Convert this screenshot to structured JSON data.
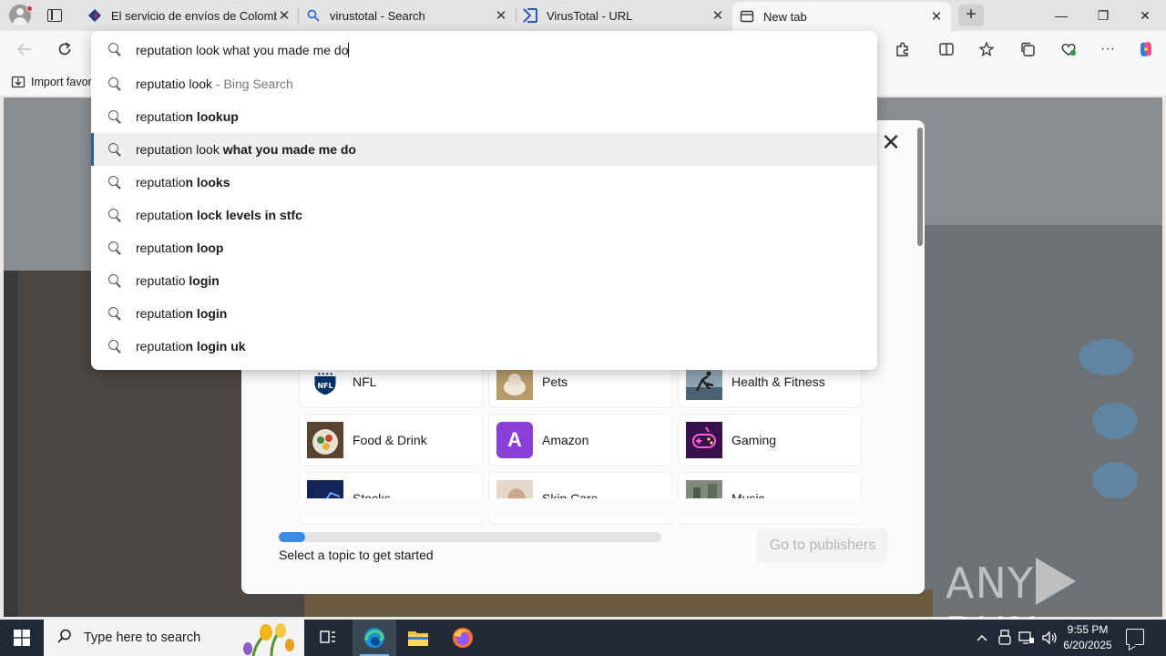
{
  "browser": {
    "tabs": [
      {
        "title": "El servicio de envíos de Colombia",
        "favicon": "servientrega-icon",
        "active": false
      },
      {
        "title": "virustotal - Search",
        "favicon": "bing-search-icon",
        "active": false
      },
      {
        "title": "VirusTotal - URL",
        "favicon": "virustotal-icon",
        "active": false
      },
      {
        "title": "New tab",
        "favicon": "newtab-icon",
        "active": true
      }
    ],
    "new_tab_glyph": "+",
    "window_controls": {
      "minimize": "—",
      "maximize": "❐",
      "close": "✕"
    },
    "favorites_bar": {
      "import_label": "Import favor"
    }
  },
  "omnibox": {
    "query": "reputation look what you made me do",
    "suggestions": [
      {
        "prefix": "reputatio look",
        "bold": "",
        "suffix": " - Bing Search",
        "selected": false
      },
      {
        "prefix": "reputatio",
        "bold": "n lookup",
        "suffix": "",
        "selected": false
      },
      {
        "prefix": "reputation look",
        "bold": " what you made me do",
        "suffix": "",
        "selected": true
      },
      {
        "prefix": "reputatio",
        "bold": "n looks",
        "suffix": "",
        "selected": false
      },
      {
        "prefix": "reputatio",
        "bold": "n lock levels in stfc",
        "suffix": "",
        "selected": false
      },
      {
        "prefix": "reputatio",
        "bold": "n loop",
        "suffix": "",
        "selected": false
      },
      {
        "prefix": "reputatio",
        "bold": " login",
        "suffix": "",
        "selected": false
      },
      {
        "prefix": "reputatio",
        "bold": "n login",
        "suffix": "",
        "selected": false
      },
      {
        "prefix": "reputatio",
        "bold": "n login uk",
        "suffix": "",
        "selected": false
      }
    ]
  },
  "topics_modal": {
    "close_glyph": "✕",
    "topics": [
      {
        "label": "NFL",
        "icon": "nfl-icon",
        "color": "#ffffff"
      },
      {
        "label": "Pets",
        "icon": "pets-icon",
        "color": "#c9a77a"
      },
      {
        "label": "Health & Fitness",
        "icon": "fitness-icon",
        "color": "#6c8aa0"
      },
      {
        "label": "Food & Drink",
        "icon": "food-icon",
        "color": "#7b5a3a"
      },
      {
        "label": "Amazon",
        "icon": "amazon-icon",
        "color": "#8b3fd9",
        "letter": "A"
      },
      {
        "label": "Gaming",
        "icon": "gaming-icon",
        "color": "#5a1a6e"
      },
      {
        "label": "Stocks",
        "icon": "stocks-icon",
        "color": "#1b2f6e"
      },
      {
        "label": "Skin Care",
        "icon": "skincare-icon",
        "color": "#d8c4b4"
      },
      {
        "label": "Music",
        "icon": "music-icon",
        "color": "#6a7a6a"
      }
    ],
    "progress_fraction": 0.07,
    "progress_text": "Select a topic to get started",
    "publishers_button": "Go to publishers"
  },
  "watermark": {
    "left": "ANY",
    "right": "RUN"
  },
  "taskbar": {
    "search_placeholder": "Type here to search",
    "time": "9:55 PM",
    "date": "6/20/2025"
  },
  "colors": {
    "accent": "#2f5ea8",
    "progress": "#3b8ae6",
    "taskbar": "#1f2a36"
  }
}
